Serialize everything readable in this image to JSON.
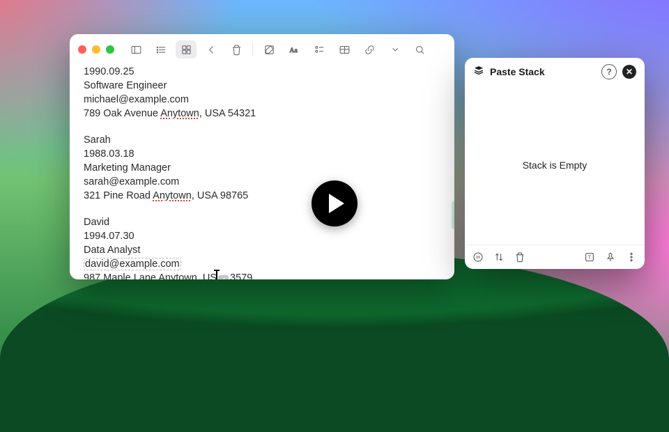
{
  "notes": {
    "partialTop": "1990.09.25",
    "entries": [
      {
        "lines": [
          "Software Engineer",
          "michael@example.com",
          "789 Oak Avenue Anytown, USA 54321"
        ]
      },
      {
        "lines": [
          "Sarah",
          "1988.03.18",
          "Marketing Manager",
          "sarah@example.com",
          "321 Pine Road Anytown, USA 98765"
        ]
      },
      {
        "lines": [
          "David",
          "1994.07.30",
          "Data Analyst",
          "david@example.com",
          "987 Maple Lane Anytown, USA 13579"
        ]
      }
    ],
    "lastFragment": {
      "pre": "987 Maple Lane Anytown, US",
      "chip": "✓",
      "post": "3579",
      "dashedEmail": "david@example.com"
    }
  },
  "toolbar": {
    "icons": [
      "sidebar",
      "list",
      "grid",
      "back",
      "trash",
      "compose",
      "font",
      "checklist",
      "table",
      "link",
      "more",
      "search"
    ]
  },
  "stack": {
    "title": "Paste Stack",
    "empty": "Stack is Empty",
    "footer": [
      "pause",
      "sort",
      "trash",
      "text-mode",
      "pin",
      "more"
    ]
  },
  "play": {
    "label": "play-video"
  }
}
